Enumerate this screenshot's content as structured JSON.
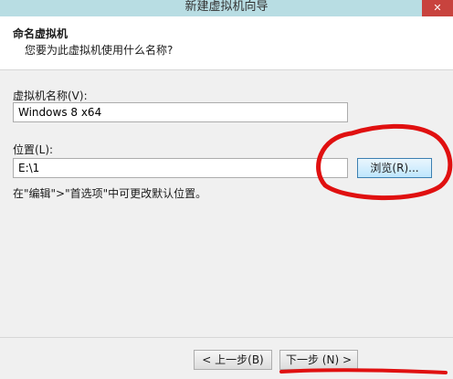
{
  "window": {
    "title": "新建虚拟机向导",
    "close_glyph": "✕"
  },
  "header": {
    "title": "命名虚拟机",
    "subtitle": "您要为此虚拟机使用什么名称?"
  },
  "form": {
    "name_label": "虚拟机名称(V):",
    "name_value": "Windows 8 x64",
    "location_label": "位置(L):",
    "location_value": "E:\\1",
    "browse_label": "浏览(R)...",
    "hint": "在\"编辑\">\"首选项\"中可更改默认位置。"
  },
  "footer": {
    "back_label": "< 上一步(B)",
    "next_label": "下一步 (N) >"
  },
  "annotation": {
    "stroke_color": "#e01010"
  }
}
